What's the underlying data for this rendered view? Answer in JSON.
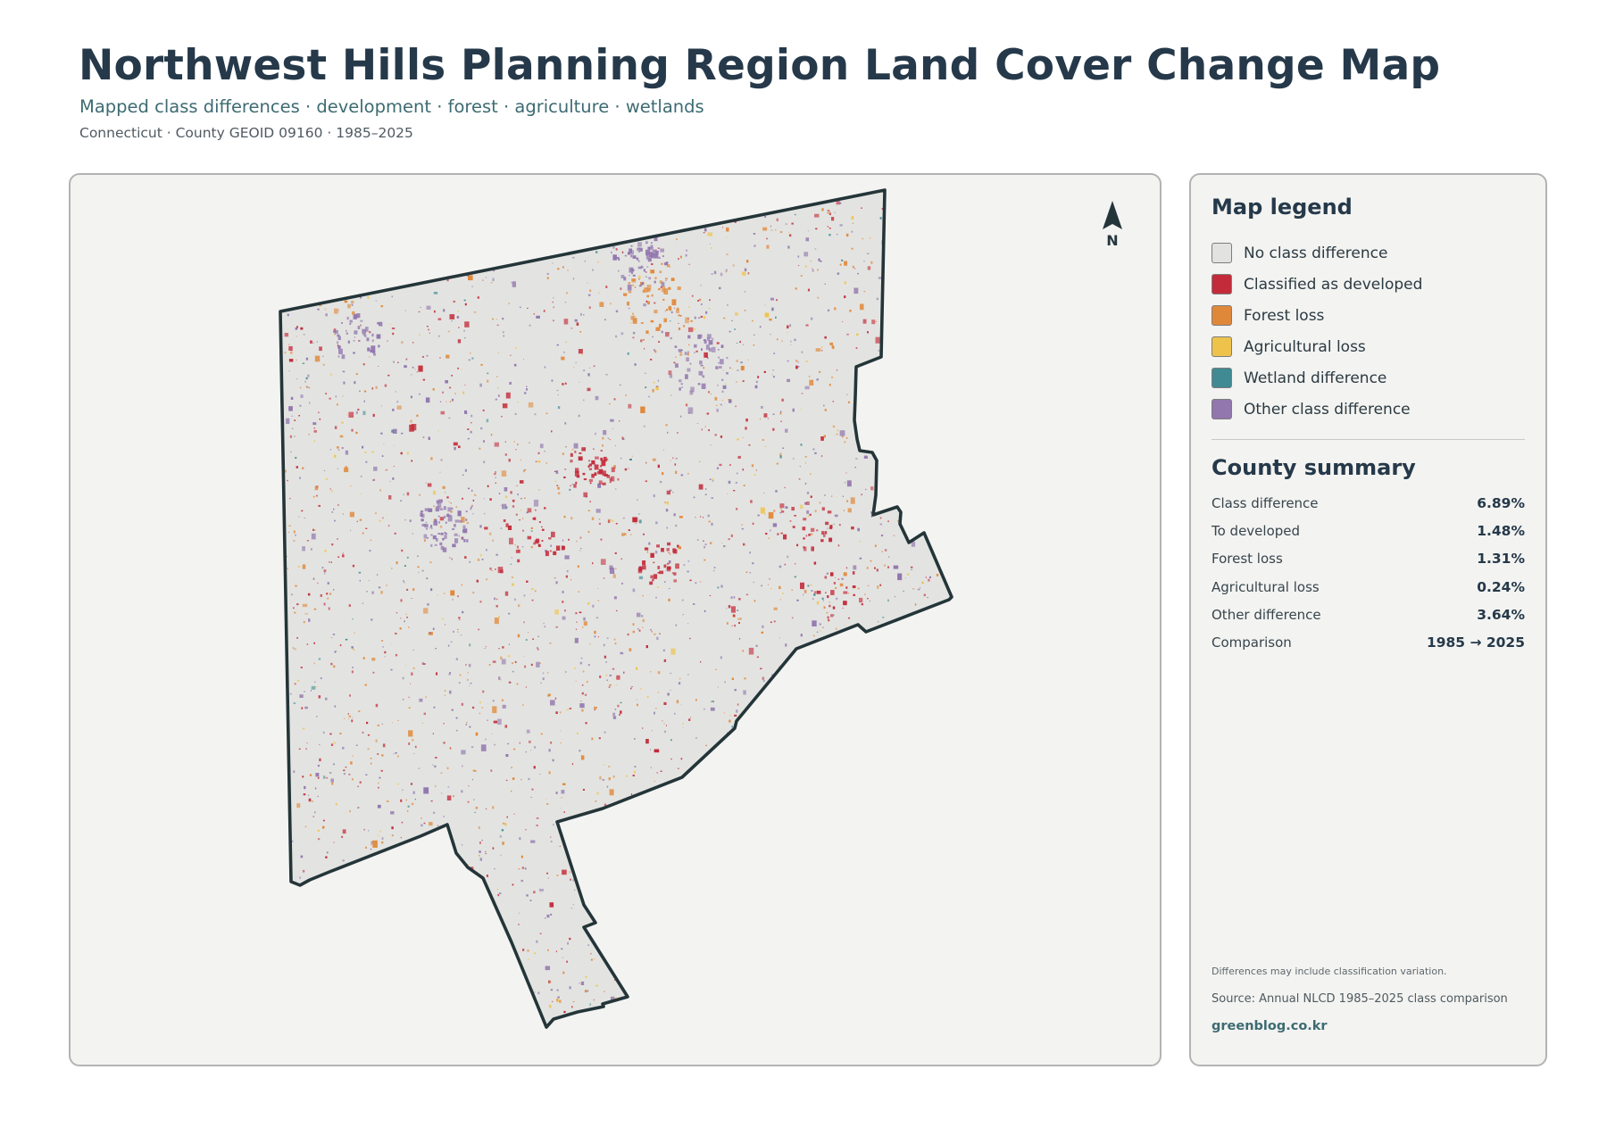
{
  "header": {
    "title": "Northwest Hills Planning Region Land Cover Change Map",
    "subtitle": "Mapped class differences · development · forest · agriculture · wetlands",
    "meta": "Connecticut · County GEOID 09160 · 1985–2025"
  },
  "map": {
    "north_label": "N",
    "region_fill": "#e3e4e1",
    "boundary_color": "#243539",
    "panel_background": "#f3f3f1"
  },
  "legend": {
    "title": "Map legend",
    "items": [
      {
        "label": "No class difference",
        "color": "#e2e2e0"
      },
      {
        "label": "Classified as developed",
        "color": "#c32b3a"
      },
      {
        "label": "Forest loss",
        "color": "#e0883a"
      },
      {
        "label": "Agricultural loss",
        "color": "#eec34c"
      },
      {
        "label": "Wetland difference",
        "color": "#3f8a93"
      },
      {
        "label": "Other class difference",
        "color": "#9276ae"
      }
    ]
  },
  "summary": {
    "title": "County summary",
    "rows": [
      {
        "label": "Class difference",
        "value": "6.89%"
      },
      {
        "label": "To developed",
        "value": "1.48%"
      },
      {
        "label": "Forest loss",
        "value": "1.31%"
      },
      {
        "label": "Agricultural loss",
        "value": "0.24%"
      },
      {
        "label": "Other difference",
        "value": "3.64%"
      },
      {
        "label": "Comparison",
        "value": "1985 → 2025"
      }
    ]
  },
  "footer": {
    "note": "Differences may include classification variation.",
    "source": "Source: Annual NLCD 1985–2025 class comparison",
    "site": "greenblog.co.kr"
  }
}
